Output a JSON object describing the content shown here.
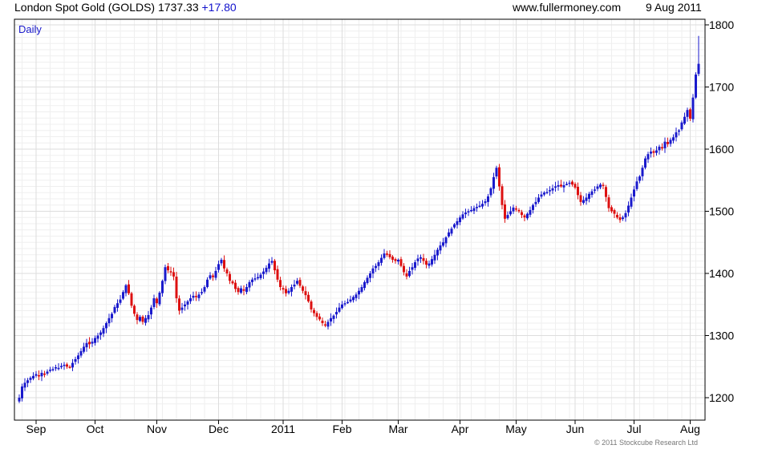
{
  "header": {
    "instrument": "London Spot Gold (GOLDS)",
    "last": "1737.33",
    "change": "+17.80",
    "source": "www.fullermoney.com",
    "date": "9 Aug 2011"
  },
  "copyright": "© 2011 Stockcube Research Ltd",
  "colors": {
    "up": "#1a1acc",
    "down": "#dd1111",
    "grid": "#dddddd",
    "frame": "#000000",
    "label": "#1a1acc"
  },
  "chart_data": {
    "type": "candlestick",
    "period_label": "Daily",
    "y_axis_position": "right",
    "ylim": [
      1180,
      1820
    ],
    "y_ticks": [
      1200,
      1300,
      1400,
      1500,
      1600,
      1700,
      1800
    ],
    "x_ticks": [
      {
        "label": "Sep",
        "index": 6
      },
      {
        "label": "Oct",
        "index": 27
      },
      {
        "label": "Nov",
        "index": 49
      },
      {
        "label": "Dec",
        "index": 71
      },
      {
        "label": "2011",
        "index": 94
      },
      {
        "label": "Feb",
        "index": 115
      },
      {
        "label": "Mar",
        "index": 135
      },
      {
        "label": "Apr",
        "index": 157
      },
      {
        "label": "May",
        "index": 177
      },
      {
        "label": "Jun",
        "index": 198
      },
      {
        "label": "Jul",
        "index": 219
      },
      {
        "label": "Aug",
        "index": 239
      }
    ],
    "close": [
      1200,
      1218,
      1224,
      1228,
      1232,
      1235,
      1238,
      1236,
      1240,
      1238,
      1242,
      1245,
      1246,
      1249,
      1248,
      1251,
      1253,
      1250,
      1249,
      1256,
      1262,
      1268,
      1275,
      1282,
      1288,
      1286,
      1290,
      1296,
      1300,
      1305,
      1312,
      1320,
      1328,
      1335,
      1346,
      1352,
      1358,
      1370,
      1381,
      1368,
      1348,
      1335,
      1325,
      1330,
      1322,
      1328,
      1333,
      1345,
      1360,
      1352,
      1369,
      1388,
      1410,
      1405,
      1402,
      1395,
      1360,
      1340,
      1345,
      1350,
      1355,
      1360,
      1364,
      1362,
      1366,
      1370,
      1378,
      1390,
      1397,
      1394,
      1404,
      1415,
      1422,
      1408,
      1400,
      1388,
      1384,
      1375,
      1370,
      1376,
      1372,
      1378,
      1386,
      1390,
      1392,
      1394,
      1398,
      1403,
      1409,
      1416,
      1420,
      1405,
      1390,
      1378,
      1374,
      1368,
      1372,
      1378,
      1382,
      1388,
      1380,
      1372,
      1365,
      1355,
      1342,
      1336,
      1330,
      1326,
      1320,
      1316,
      1322,
      1328,
      1332,
      1338,
      1345,
      1350,
      1352,
      1354,
      1358,
      1362,
      1366,
      1372,
      1378,
      1386,
      1393,
      1400,
      1408,
      1412,
      1418,
      1425,
      1432,
      1430,
      1426,
      1422,
      1420,
      1422,
      1412,
      1402,
      1395,
      1404,
      1410,
      1418,
      1424,
      1426,
      1420,
      1414,
      1416,
      1423,
      1430,
      1438,
      1445,
      1450,
      1458,
      1466,
      1472,
      1479,
      1484,
      1490,
      1495,
      1498,
      1500,
      1502,
      1505,
      1507,
      1509,
      1512,
      1516,
      1524,
      1537,
      1555,
      1570,
      1540,
      1510,
      1488,
      1494,
      1500,
      1506,
      1503,
      1500,
      1494,
      1490,
      1496,
      1502,
      1510,
      1515,
      1522,
      1527,
      1530,
      1531,
      1534,
      1537,
      1540,
      1542,
      1540,
      1542,
      1544,
      1546,
      1543,
      1538,
      1526,
      1515,
      1518,
      1522,
      1528,
      1532,
      1535,
      1540,
      1543,
      1541,
      1523,
      1505,
      1500,
      1496,
      1490,
      1486,
      1490,
      1497,
      1509,
      1522,
      1535,
      1548,
      1556,
      1570,
      1585,
      1592,
      1596,
      1594,
      1598,
      1604,
      1603,
      1612,
      1608,
      1615,
      1619,
      1627,
      1630,
      1643,
      1652,
      1663,
      1649,
      1683,
      1720,
      1737.33
    ],
    "up_color": "#1a1acc",
    "down_color": "#dd1111"
  }
}
